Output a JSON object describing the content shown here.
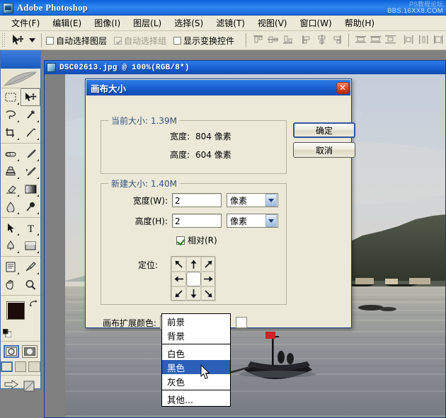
{
  "app": {
    "title": "Adobe Photoshop",
    "watermark_line1": "PS教程论坛",
    "watermark_line2": "BBS.16XX8.COM"
  },
  "menubar": {
    "items": [
      {
        "label": "文件(F)"
      },
      {
        "label": "编辑(E)"
      },
      {
        "label": "图像(I)"
      },
      {
        "label": "图层(L)"
      },
      {
        "label": "选择(S)"
      },
      {
        "label": "滤镜(T)"
      },
      {
        "label": "视图(V)"
      },
      {
        "label": "窗口(W)"
      },
      {
        "label": "帮助(H)"
      }
    ]
  },
  "options_bar": {
    "tool_icon": "move-tool-icon",
    "auto_select_layer": {
      "label": "自动选择图层",
      "checked": false,
      "enabled": true
    },
    "auto_select_group": {
      "label": "自动选择组",
      "checked": true,
      "enabled": false
    },
    "show_transform_controls": {
      "label": "显示变换控件",
      "checked": false,
      "enabled": true
    },
    "align_buttons": [
      "align-top-edges",
      "align-vertical-centers",
      "align-bottom-edges",
      "align-left-edges",
      "align-horizontal-centers",
      "align-right-edges"
    ],
    "distribute_buttons": [
      "distribute-top-edges",
      "distribute-vertical-centers",
      "distribute-bottom-edges",
      "distribute-left-edges",
      "distribute-horizontal-centers",
      "distribute-right-edges"
    ]
  },
  "toolbox": {
    "tools": [
      {
        "name": "marquee-tool-icon",
        "selected": false
      },
      {
        "name": "move-tool-icon",
        "selected": true
      },
      {
        "name": "lasso-tool-icon",
        "selected": false
      },
      {
        "name": "magic-wand-tool-icon",
        "selected": false
      },
      {
        "name": "crop-tool-icon",
        "selected": false
      },
      {
        "name": "slice-tool-icon",
        "selected": false
      },
      {
        "name": "healing-brush-tool-icon",
        "selected": false
      },
      {
        "name": "brush-tool-icon",
        "selected": false
      },
      {
        "name": "clone-stamp-tool-icon",
        "selected": false
      },
      {
        "name": "history-brush-tool-icon",
        "selected": false
      },
      {
        "name": "eraser-tool-icon",
        "selected": false
      },
      {
        "name": "gradient-tool-icon",
        "selected": false
      },
      {
        "name": "blur-tool-icon",
        "selected": false
      },
      {
        "name": "dodge-tool-icon",
        "selected": false
      },
      {
        "name": "path-selection-tool-icon",
        "selected": false
      },
      {
        "name": "type-tool-icon",
        "selected": false
      },
      {
        "name": "pen-tool-icon",
        "selected": false
      },
      {
        "name": "shape-tool-icon",
        "selected": false
      },
      {
        "name": "notes-tool-icon",
        "selected": false
      },
      {
        "name": "eyedropper-tool-icon",
        "selected": false
      },
      {
        "name": "hand-tool-icon",
        "selected": false
      },
      {
        "name": "zoom-tool-icon",
        "selected": false
      }
    ],
    "foreground_color": "#1a0d08",
    "background_color": "#ffffff",
    "mask_modes": [
      "standard-mask-mode",
      "quick-mask-mode"
    ],
    "screen_modes": [
      "standard-screen-mode",
      "full-screen-with-menubar",
      "full-screen-mode"
    ],
    "jump_to": [
      "jump-to-imageready-icon",
      "jump-to-other-icon"
    ]
  },
  "document": {
    "title": "DSC02613.jpg @ 100%(RGB/8*)",
    "icon": "image-document-icon"
  },
  "dialog": {
    "title": "画布大小",
    "close_label": "✕",
    "current_size": {
      "legend": "当前大小: 1.39M",
      "width_label": "宽度:",
      "width_value": "804 像素",
      "height_label": "高度:",
      "height_value": "604 像素"
    },
    "new_size": {
      "legend": "新建大小: 1.40M",
      "width_label": "宽度(W):",
      "width_value": "2",
      "width_unit": "像素",
      "height_label": "高度(H):",
      "height_value": "2",
      "height_unit": "像素",
      "relative_label": "相对(R)",
      "relative_checked": true,
      "anchor_label": "定位:",
      "anchor_position": "center"
    },
    "extension_color": {
      "label": "画布扩展颜色:",
      "value": "前景",
      "swatch_color": "#ffffff"
    },
    "buttons": {
      "ok": "确定",
      "cancel": "取消"
    }
  },
  "dropdown": {
    "selected": "黑色",
    "groups": [
      {
        "items": [
          "前景",
          "背景"
        ]
      },
      {
        "items": [
          "白色",
          "黑色",
          "灰色"
        ]
      },
      {
        "items": [
          "其他..."
        ]
      }
    ]
  }
}
